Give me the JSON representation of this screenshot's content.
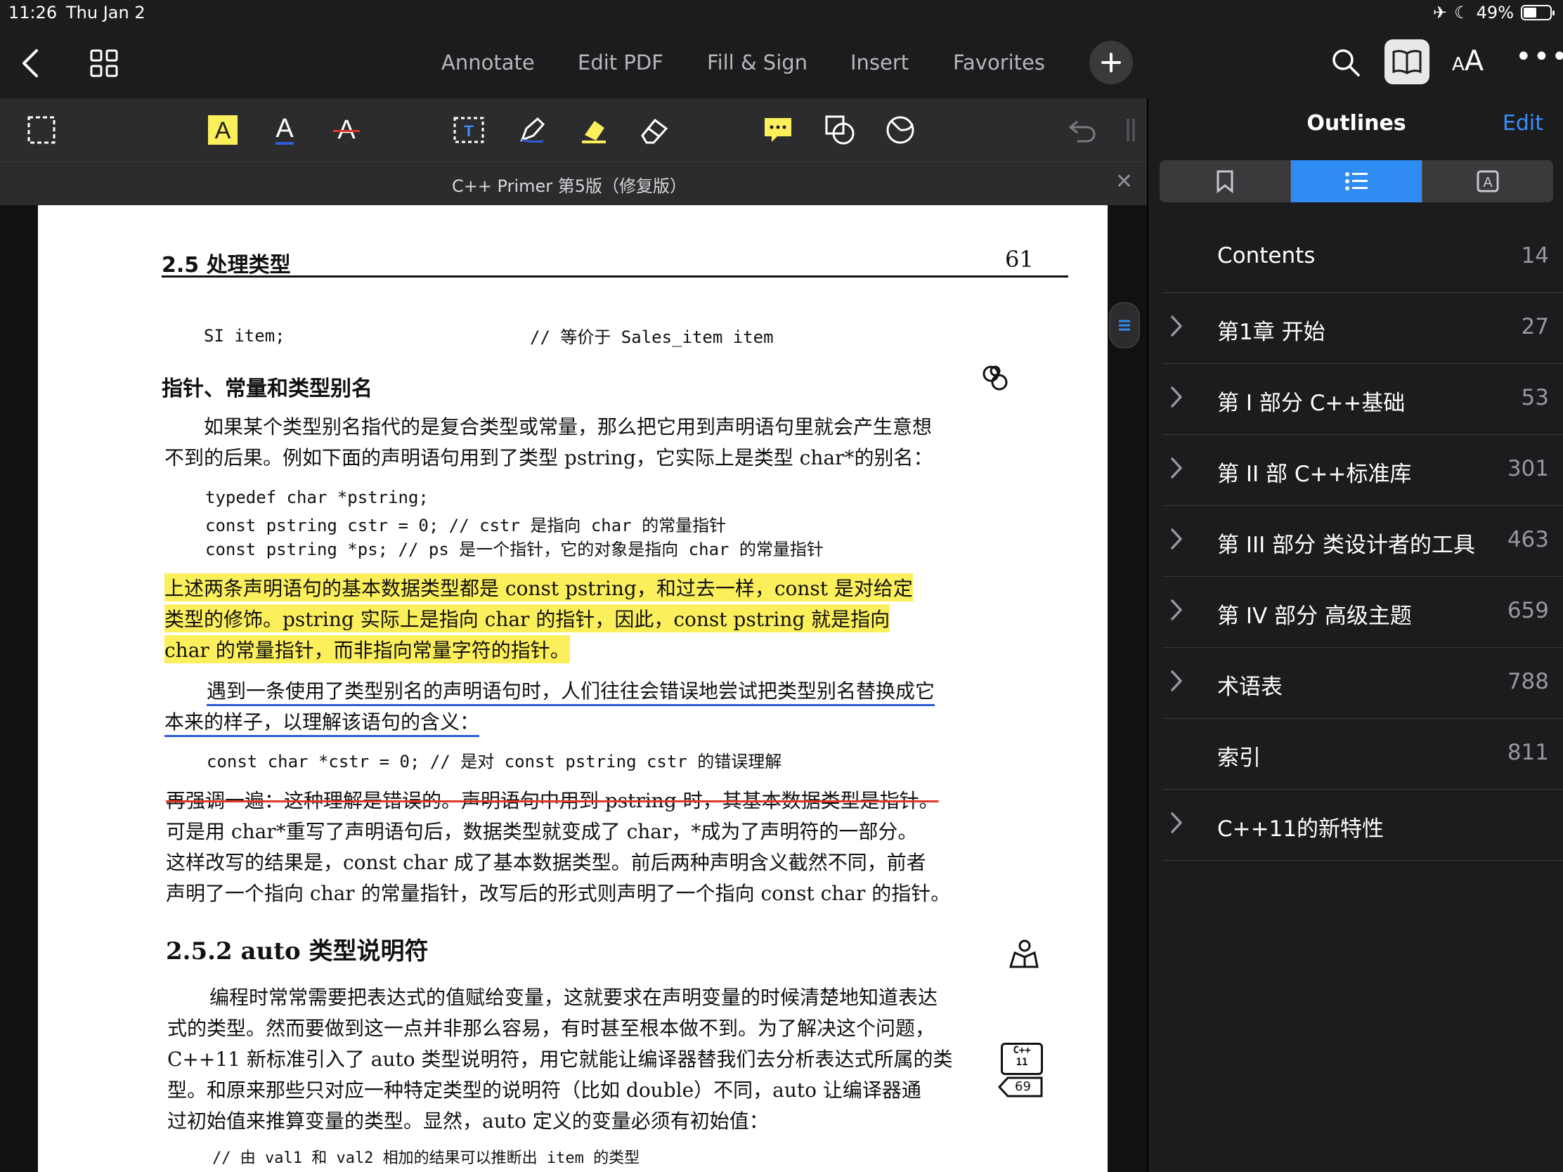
{
  "status_bar": {
    "time": "11:26",
    "date": "Thu Jan 2",
    "battery": "49%"
  },
  "nav": {
    "tabs": [
      "Annotate",
      "Edit PDF",
      "Fill & Sign",
      "Insert",
      "Favorites"
    ],
    "font_size_label": "AA"
  },
  "document": {
    "title": "C++ Primer 第5版（修复版）",
    "page": {
      "section_header": "2.5   处理类型",
      "page_number": "61",
      "lines": [
        {
          "text": "SI item;",
          "style": "mono"
        },
        {
          "text": "// 等价于 Sales_item item",
          "style": "mono"
        },
        {
          "text": "指针、常量和类型别名",
          "style": "heading"
        },
        {
          "text": "如果某个类型别名指代的是复合类型或常量，那么把它用到声明语句里就会产生意想",
          "style": "body"
        },
        {
          "text": "不到的后果。例如下面的声明语句用到了类型 pstring，它实际上是类型 char*的别名：",
          "style": "body"
        },
        {
          "text": "typedef char *pstring;",
          "style": "mono"
        },
        {
          "text": "const pstring cstr = 0;   // cstr 是指向 char 的常量指针",
          "style": "mono"
        },
        {
          "text": "const pstring *ps;        // ps 是一个指针，它的对象是指向 char 的常量指针",
          "style": "mono"
        },
        {
          "text": "上述两条声明语句的基本数据类型都是 const pstring，和过去一样，const 是对给定",
          "style": "highlight"
        },
        {
          "text": "类型的修饰。pstring 实际上是指向 char 的指针，因此，const pstring 就是指向",
          "style": "highlight"
        },
        {
          "text": "char 的常量指针，而非指向常量字符的指针。",
          "style": "highlight"
        },
        {
          "text": "遇到一条使用了类型别名的声明语句时，人们往往会错误地尝试把类型别名替换成它",
          "style": "underline"
        },
        {
          "text": "本来的样子，以理解该语句的含义：",
          "style": "underline"
        },
        {
          "text": "const char *cstr = 0;     // 是对 const pstring cstr 的错误理解",
          "style": "mono"
        },
        {
          "text": "再强调一遍：这种理解是错误的。声明语句中用到 pstring 时，其基本数据类型是指针。",
          "style": "strike"
        },
        {
          "text": "可是用 char*重写了声明语句后，数据类型就变成了 char，*成为了声明符的一部分。",
          "style": "body"
        },
        {
          "text": "这样改写的结果是，const char 成了基本数据类型。前后两种声明含义截然不同，前者",
          "style": "body"
        },
        {
          "text": "声明了一个指向 char 的常量指针，改写后的形式则声明了一个指向 const char 的指针。",
          "style": "body"
        },
        {
          "text": "2.5.2   auto 类型说明符",
          "style": "heading2"
        },
        {
          "text": "编程时常常需要把表达式的值赋给变量，这就要求在声明变量的时候清楚地知道表达",
          "style": "body"
        },
        {
          "text": "式的类型。然而要做到这一点并非那么容易，有时甚至根本做不到。为了解决这个问题，",
          "style": "body"
        },
        {
          "text": "C++11 新标准引入了 auto 类型说明符，用它就能让编译器替我们去分析表达式所属的类",
          "style": "body"
        },
        {
          "text": "型。和原来那些只对应一种特定类型的说明符（比如 double）不同，auto 让编译器通",
          "style": "body"
        },
        {
          "text": "过初始值来推算变量的类型。显然，auto 定义的变量必须有初始值：",
          "style": "body"
        },
        {
          "text": "// 由 val1 和 val2 相加的结果可以推断出 item 的类型",
          "style": "mono"
        }
      ],
      "margin_badge": {
        "top": "C++",
        "bottom": "11",
        "ref": "69"
      }
    }
  },
  "panel": {
    "title": "Outlines",
    "edit_label": "Edit",
    "segments": [
      "bookmark-icon",
      "list-icon",
      "text-box-icon"
    ],
    "items": [
      {
        "label": "Contents",
        "page": "14",
        "expandable": false
      },
      {
        "label": "第1章 开始",
        "page": "27",
        "expandable": true
      },
      {
        "label": "第 I 部分 C++基础",
        "page": "53",
        "expandable": true
      },
      {
        "label": "第 II 部 C++标准库",
        "page": "301",
        "expandable": true
      },
      {
        "label": "第 III 部分 类设计者的工具",
        "page": "463",
        "expandable": true
      },
      {
        "label": "第 IV 部分 高级主题",
        "page": "659",
        "expandable": true
      },
      {
        "label": "术语表",
        "page": "788",
        "expandable": true
      },
      {
        "label": "索引",
        "page": "811",
        "expandable": false
      },
      {
        "label": "C++11的新特性",
        "page": "",
        "expandable": true
      }
    ]
  },
  "colors": {
    "accent": "#2f8cf2",
    "highlight": "#fbef5c",
    "underline": "#2f5bd6",
    "strike": "#e0372a"
  }
}
